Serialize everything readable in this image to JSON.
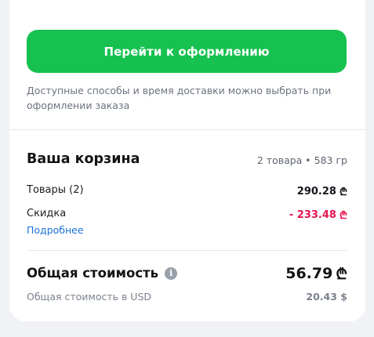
{
  "checkout": {
    "button_label": "Перейти к оформлению",
    "note": "Доступные способы и время доставки можно выбрать при оформлении заказа"
  },
  "cart": {
    "title": "Ваша корзина",
    "summary": "2 товара • 583 гр",
    "goods_label": "Товары (2)",
    "goods_value": "290.28",
    "discount_label": "Скидка",
    "discount_value": "- 233.48",
    "details_link": "Подробнее",
    "total_label": "Общая стоимость",
    "total_value": "56.79",
    "usd_label": "Общая стоимость в USD",
    "usd_value": "20.43 $",
    "currency_symbol": "₾"
  },
  "icons": {
    "info": "info-icon"
  },
  "colors": {
    "primary_button": "#16c150",
    "discount": "#e8164f",
    "link": "#1a73d8"
  }
}
